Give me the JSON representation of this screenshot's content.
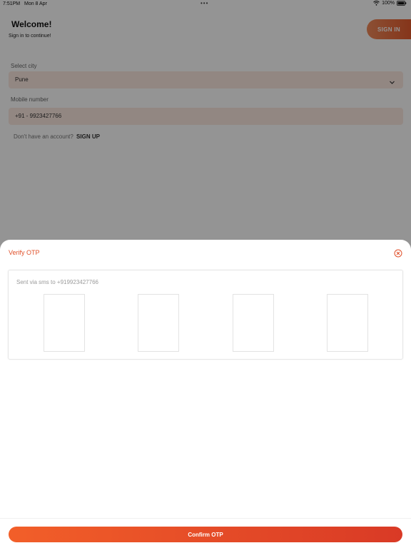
{
  "status_bar": {
    "time": "7:51PM",
    "date": "Mon 8 Apr",
    "dots": "•••",
    "battery": "100%"
  },
  "header": {
    "title": "Welcome!",
    "subtitle": "Sign in to continue!",
    "signin_label": "SIGN IN"
  },
  "form": {
    "city_label": "Select city",
    "city_value": "Pune",
    "mobile_label": "Mobile number",
    "mobile_value": "+91 - 9923427766",
    "signup_prompt": "Don't have an account?",
    "signup_link": "SIGN UP"
  },
  "otp_sheet": {
    "title": "Verify OTP",
    "sent_text": "Sent via sms to +919923427766",
    "digits": [
      "",
      "",
      "",
      ""
    ],
    "confirm_label": "Confirm OTP"
  },
  "colors": {
    "accent": "#e0502a",
    "button_start": "#f25f29",
    "button_end": "#d93a26",
    "input_bg": "#fbe9e1"
  },
  "icons": [
    "wifi-icon",
    "battery-icon",
    "chevron-down-icon",
    "close-icon"
  ]
}
